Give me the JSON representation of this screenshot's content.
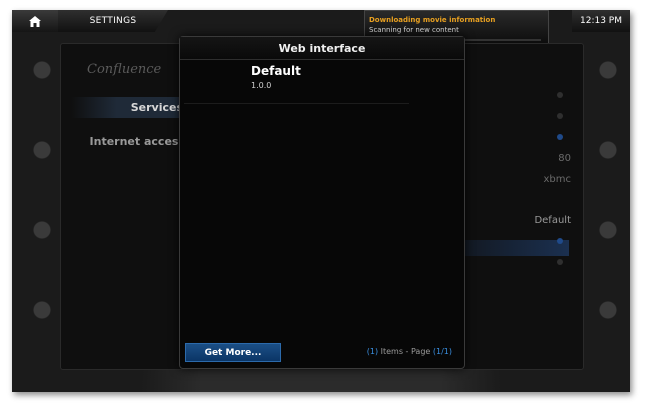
{
  "topbar": {
    "title": "SETTINGS",
    "clock": "12:13 PM",
    "notification": {
      "title": "Downloading movie information",
      "message": "Scanning for new content",
      "progress": 0.0
    }
  },
  "background": {
    "logo": "Confluence",
    "categories": [
      {
        "label": "Services",
        "selected": true
      },
      {
        "label": "Internet access",
        "selected": false
      }
    ],
    "values": {
      "port": "80",
      "username": "xbmc",
      "web_interface": "Default"
    }
  },
  "dialog": {
    "title": "Web interface",
    "items": [
      {
        "name": "Default",
        "version": "1.0.0"
      }
    ],
    "get_more_label": "Get More...",
    "count_open": "(",
    "count": "1",
    "count_mid": ") Items - Page (",
    "page": "1/1",
    "count_close": ")"
  },
  "colors": {
    "notification_title": "#e8a020",
    "accent_blue": "#3a8fe0",
    "button_blue": "#0b3566"
  },
  "icons": {
    "home": "home-icon"
  }
}
